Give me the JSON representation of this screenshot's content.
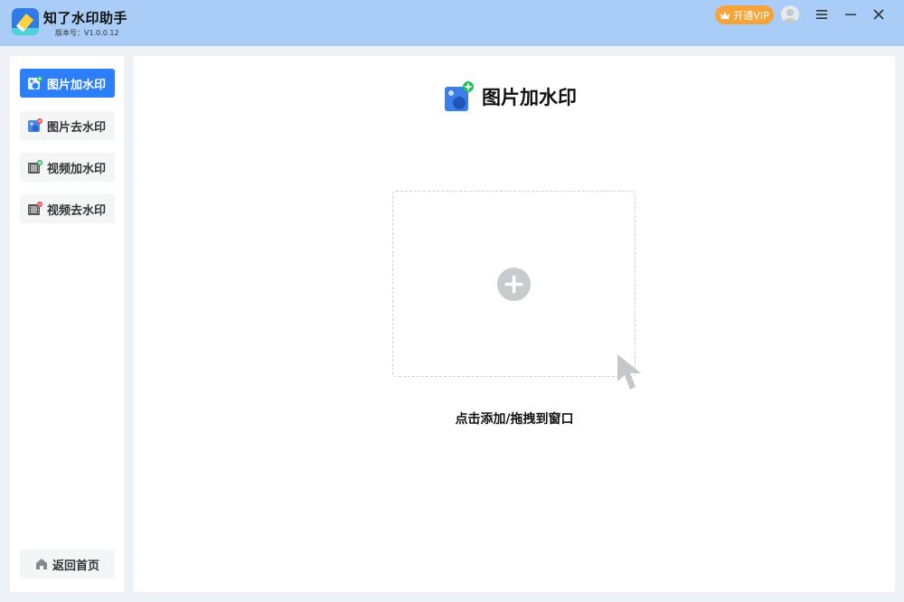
{
  "app": {
    "name": "知了水印助手",
    "version": "版本号：V1.0.0.12"
  },
  "titlebar": {
    "vip_label": "开通VIP"
  },
  "sidebar": {
    "items": [
      {
        "label": "图片加水印",
        "active": true
      },
      {
        "label": "图片去水印",
        "active": false
      },
      {
        "label": "视频加水印",
        "active": false
      },
      {
        "label": "视频去水印",
        "active": false
      }
    ],
    "home_label": "返回首页"
  },
  "main": {
    "title": "图片加水印",
    "hint": "点击添加/拖拽到窗口"
  },
  "colors": {
    "titlebar": "#a9cdf6",
    "accent": "#2d7ff9",
    "vip": "#f4a43a",
    "add_badge": "#20c05c",
    "remove_badge": "#ef4d4d"
  }
}
